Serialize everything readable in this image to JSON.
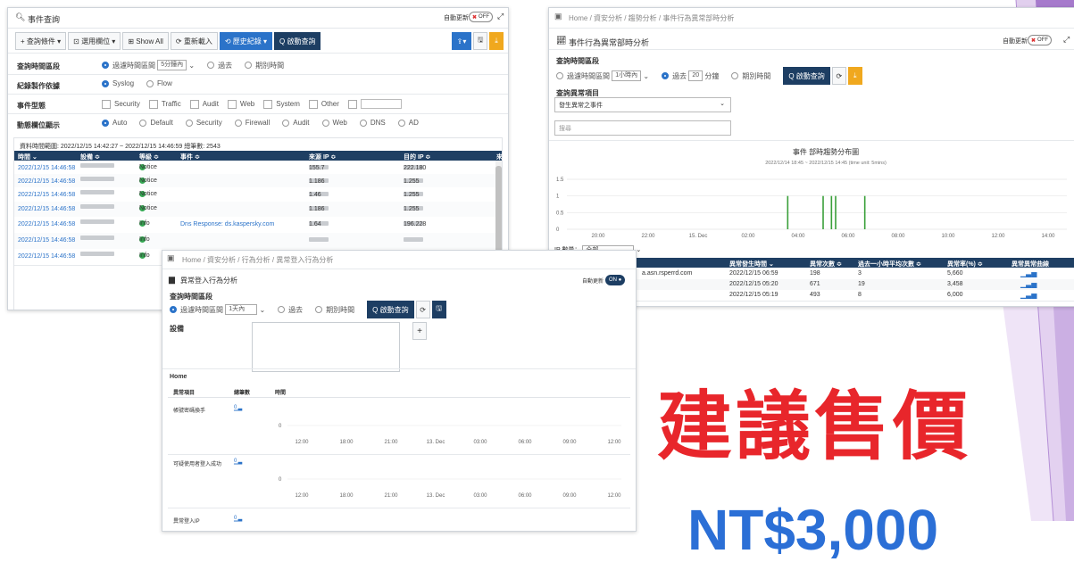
{
  "panel1": {
    "title": "事件查詢",
    "auto_update_label": "自動更新",
    "auto_update_state": "OFF",
    "toolbar": {
      "add_condition": "+ 查詢條件 ▾",
      "select_columns": "⊡ 選用欄位 ▾",
      "show_all": "⊞ Show All",
      "reload": "⟳ 重新載入",
      "history": "⟲ 歷史紀錄 ▾",
      "start_query": "Q 啟動查詢"
    },
    "time_range": {
      "label": "查詢時間區段",
      "opt1": "過濾時間區間",
      "opt1_value": "5分鐘內",
      "opt2": "過去",
      "opt3": "期別時間"
    },
    "source": {
      "label": "紀錄製作依據",
      "opt1": "Syslog",
      "opt2": "Flow"
    },
    "event_type": {
      "label": "事件型態",
      "options": [
        "Security",
        "Traffic",
        "Audit",
        "Web",
        "System",
        "Other"
      ]
    },
    "display": {
      "label": "動態欄位顯示",
      "options": [
        "Auto",
        "Default",
        "Security",
        "Firewall",
        "Audit",
        "Web",
        "DNS",
        "AD"
      ]
    },
    "summary": "資料時間範圍: 2022/12/15 14:42:27 ~ 2022/12/15 14:46:59   總筆數: 2543",
    "table": {
      "headers": [
        "時間 ⌄",
        "設備 ≎",
        "等級 ≎",
        "事件 ≎",
        "來源 IP ≎",
        "目的 IP ≎"
      ],
      "rows": [
        {
          "time": "2022/12/15 14:46:58",
          "level": "Notice",
          "event": "",
          "src": "155.7",
          "dst": "222.180"
        },
        {
          "time": "2022/12/15 14:46:58",
          "level": "Notice",
          "event": "",
          "src": "1.186",
          "dst": "1.255"
        },
        {
          "time": "2022/12/15 14:46:58",
          "level": "Notice",
          "event": "",
          "src": "1.46",
          "dst": "1.255"
        },
        {
          "time": "2022/12/15 14:46:58",
          "level": "Notice",
          "event": "",
          "src": "1.186",
          "dst": "1.255"
        },
        {
          "time": "2022/12/15 14:46:58",
          "level": "Info",
          "event": "Dns Response: ds.kaspersky.com",
          "src": "1.64",
          "dst": "196.228"
        },
        {
          "time": "2022/12/15 14:46:58",
          "level": "Info",
          "event": "",
          "src": "",
          "dst": ""
        },
        {
          "time": "2022/12/15 14:46:58",
          "level": "Info",
          "event": "",
          "src": "",
          "dst": ""
        }
      ]
    }
  },
  "panel2": {
    "breadcrumb": "Home / 資安分析 / 趨勢分析 / 事件行為異常部時分析",
    "title": "事件行為異常部時分析",
    "auto_update_label": "自動更新",
    "auto_update_state": "OFF",
    "time_range": {
      "label": "查詢時間區段",
      "opt1": "過濾時間區間",
      "opt1_value": "1小時內",
      "opt2": "過去",
      "opt2_value": "20",
      "opt2_unit": "分鐘",
      "opt3": "期別時間",
      "start_query": "Q 啟動查詢"
    },
    "item": {
      "label": "查詢異常項目",
      "value": "發生異常之事件",
      "search_placeholder": "搜尋"
    },
    "chart_title": "事件 部時趨勢分布圖",
    "chart_subtitle": "2022/12/14 18:45 ~ 2022/12/15 14:45 (time unit: 5mins)",
    "ip_label": "IP 數量：",
    "ip_value": "全部",
    "table": {
      "headers": [
        "異常發生時間 ⌄",
        "異常次數 ≎",
        "過去一小時平均次數 ≎",
        "異常率(%) ≎",
        "異常異常曲線"
      ],
      "rows": [
        {
          "host": "a.asn.rsperrd.com",
          "time": "2022/12/15 06:59",
          "count": "198",
          "avg": "3",
          "rate": "5,660"
        },
        {
          "host": "",
          "time": "2022/12/15 05:20",
          "count": "671",
          "avg": "19",
          "rate": "3,458"
        },
        {
          "host": "",
          "time": "2022/12/15 05:19",
          "count": "493",
          "avg": "8",
          "rate": "6,000"
        }
      ]
    }
  },
  "panel3": {
    "breadcrumb": "Home / 資安分析 / 行為分析 / 異常登入行為分析",
    "title": "異常登入行為分析",
    "auto_update_label": "自動更新",
    "auto_update_state": "ON",
    "time_range": {
      "label": "查詢時間區段",
      "opt1": "過濾時間區間",
      "opt1_value": "1天內",
      "opt2": "過去",
      "opt3": "期別時間",
      "start_query": "Q 啟動查詢"
    },
    "device_label": "設備",
    "section": "Home",
    "table": {
      "headers": [
        "異常項目",
        "總筆數",
        "時間"
      ],
      "rows": [
        {
          "name": "帳號密碼換手",
          "count": "0"
        },
        {
          "name": "可疑使用者登入成功",
          "count": "0"
        },
        {
          "name": "異常登入IP",
          "count": "0"
        }
      ],
      "axis_zero": "0",
      "axis_labels": [
        "12:00",
        "18:00",
        "21:00",
        "13. Dec",
        "03:00",
        "06:00",
        "09:00",
        "12:00"
      ]
    }
  },
  "chart_data": {
    "type": "bar",
    "title": "事件 部時趨勢分布圖",
    "subtitle": "2022/12/14 18:45 ~ 2022/12/15 14:45 (time unit: 5mins)",
    "x_labels": [
      "20:00",
      "22:00",
      "15. Dec",
      "02:00",
      "04:00",
      "06:00",
      "08:00",
      "10:00",
      "12:00",
      "14:00"
    ],
    "ylim": [
      0,
      1.5
    ],
    "y_ticks": [
      "1.5",
      "1",
      "0.5",
      "0"
    ],
    "bars": [
      {
        "time": "03:35",
        "value": 1
      },
      {
        "time": "05:00",
        "value": 1
      },
      {
        "time": "05:20",
        "value": 1
      },
      {
        "time": "05:30",
        "value": 1
      },
      {
        "time": "06:40",
        "value": 1
      }
    ],
    "color": "#3aa03a"
  },
  "promo": {
    "headline": "建議售價",
    "price": "NT$3,000"
  },
  "colors": {
    "navy": "#1d3e63",
    "blue": "#2b73c9",
    "orange": "#f0a81e",
    "green": "#35a853",
    "red": "#e8262b",
    "purple": "#9b6bc6"
  }
}
